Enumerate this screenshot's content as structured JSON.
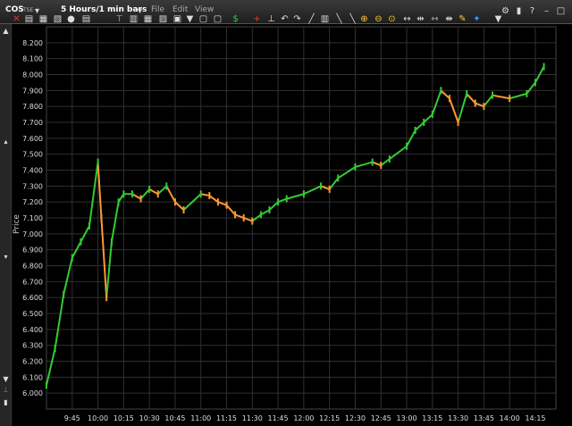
{
  "toolbar": {
    "symbol": "COS",
    "exchange": "TSE",
    "timeframe": "5 Hours/1 min bars",
    "menus": [
      "File",
      "Edit",
      "View"
    ],
    "icons": [
      "settings-icon",
      "chart-type-icon",
      "print-icon",
      "copy-icon",
      "zoom-in-icon",
      "zoom-out-icon",
      "fit-icon",
      "new-window-icon",
      "image-icon",
      "dropdown-icon",
      "dollar-icon",
      "crosshair-icon",
      "undo-icon",
      "redo-icon",
      "line-icon",
      "magnifier-icon",
      "pin-icon",
      "wrench-icon",
      "more-icon"
    ]
  },
  "axis": {
    "ylabel": "Price"
  },
  "colors": {
    "up": "#33cc33",
    "down": "#ff9933",
    "grid": "#303030",
    "background": "#000000"
  },
  "chart_data": {
    "type": "line",
    "ylabel": "Price",
    "ylim": [
      5.9,
      8.3
    ],
    "yticks": [
      "6.000",
      "6.100",
      "6.200",
      "6.300",
      "6.400",
      "6.500",
      "6.600",
      "6.700",
      "6.800",
      "6.900",
      "7.000",
      "7.100",
      "7.200",
      "7.300",
      "7.400",
      "7.500",
      "7.600",
      "7.700",
      "7.800",
      "7.900",
      "8.000",
      "8.100",
      "8.200"
    ],
    "xticks": [
      "9:45",
      "10:00",
      "10:15",
      "10:30",
      "10:45",
      "11:00",
      "11:15",
      "11:30",
      "11:45",
      "12:00",
      "12:15",
      "12:30",
      "12:45",
      "13:00",
      "13:15",
      "13:30",
      "13:45",
      "14:00",
      "14:15"
    ],
    "series": [
      {
        "x": [
          "9:30",
          "9:35",
          "9:40",
          "9:45",
          "9:50",
          "9:55",
          "10:00",
          "10:02",
          "10:05",
          "10:08",
          "10:12",
          "10:15",
          "10:20",
          "10:25",
          "10:30",
          "10:35",
          "10:40",
          "10:45",
          "10:50",
          "11:00",
          "11:05",
          "11:10",
          "11:15",
          "11:20",
          "11:25",
          "11:30",
          "11:35",
          "11:40",
          "11:45",
          "11:50",
          "12:00",
          "12:10",
          "12:15",
          "12:20",
          "12:30",
          "12:40",
          "12:45",
          "12:50",
          "13:00",
          "13:05",
          "13:10",
          "13:15",
          "13:20",
          "13:25",
          "13:30",
          "13:35",
          "13:40",
          "13:45",
          "13:50",
          "14:00",
          "14:10",
          "14:15",
          "14:20"
        ],
        "y": [
          6.05,
          6.28,
          6.62,
          6.85,
          6.95,
          7.05,
          7.45,
          7.1,
          6.6,
          6.95,
          7.2,
          7.25,
          7.25,
          7.22,
          7.28,
          7.25,
          7.3,
          7.2,
          7.15,
          7.25,
          7.24,
          7.2,
          7.18,
          7.12,
          7.1,
          7.08,
          7.12,
          7.15,
          7.2,
          7.22,
          7.25,
          7.3,
          7.28,
          7.35,
          7.42,
          7.45,
          7.43,
          7.47,
          7.55,
          7.65,
          7.7,
          7.75,
          7.9,
          7.85,
          7.7,
          7.88,
          7.82,
          7.8,
          7.87,
          7.85,
          7.88,
          7.95,
          8.05
        ]
      }
    ]
  }
}
